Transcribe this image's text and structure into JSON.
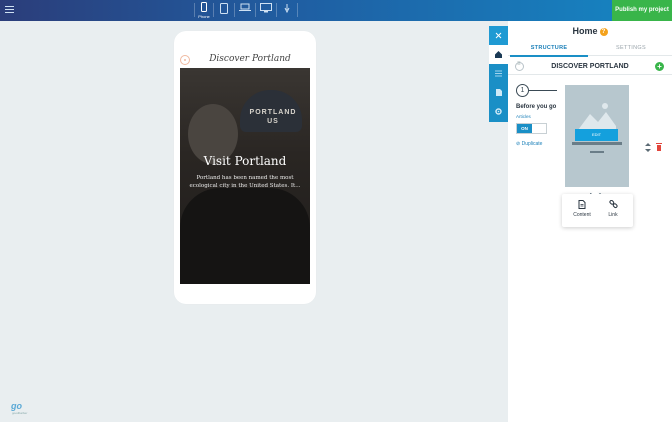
{
  "topbar": {
    "devices": [
      {
        "name": "phone",
        "label": "Phone",
        "active": true
      },
      {
        "name": "tablet-portrait",
        "label": "",
        "active": false
      },
      {
        "name": "laptop",
        "label": "",
        "active": false
      },
      {
        "name": "desktop",
        "label": "",
        "active": false
      },
      {
        "name": "touch",
        "label": "",
        "active": false
      }
    ],
    "publish_label": "Publish my project"
  },
  "preview": {
    "site_title": "Discover Portland",
    "cap_text_line1": "PORTLAND",
    "cap_text_line2": "US",
    "hero_title": "Visit Portland",
    "hero_text": "Portland has been named the most ecological city in the United States. It..."
  },
  "logo": {
    "text": "go",
    "subtext": "goodbarber"
  },
  "side_rail": {
    "items": [
      "close-icon",
      "home-icon",
      "list-icon",
      "page-icon",
      "settings-icon"
    ],
    "active": "home-icon"
  },
  "panel": {
    "title": "Home",
    "help": "?",
    "tabs": [
      {
        "label": "STRUCTURE",
        "active": true
      },
      {
        "label": "SETTINGS",
        "active": false
      }
    ],
    "section_title": "DISCOVER PORTLAND",
    "add_label": "+",
    "item": {
      "index": "1",
      "name": "Before you go",
      "type": "Articles",
      "toggle_label": "ON",
      "duplicate_label": "Duplicate",
      "thumb_button": "EDIT"
    },
    "popover": {
      "items": [
        {
          "label": "Content"
        },
        {
          "label": "Link"
        }
      ]
    }
  },
  "colors": {
    "accent": "#1a8fc6",
    "publish": "#39b54a",
    "help": "#f4a21c",
    "canvas_bg": "#e9eef0"
  }
}
